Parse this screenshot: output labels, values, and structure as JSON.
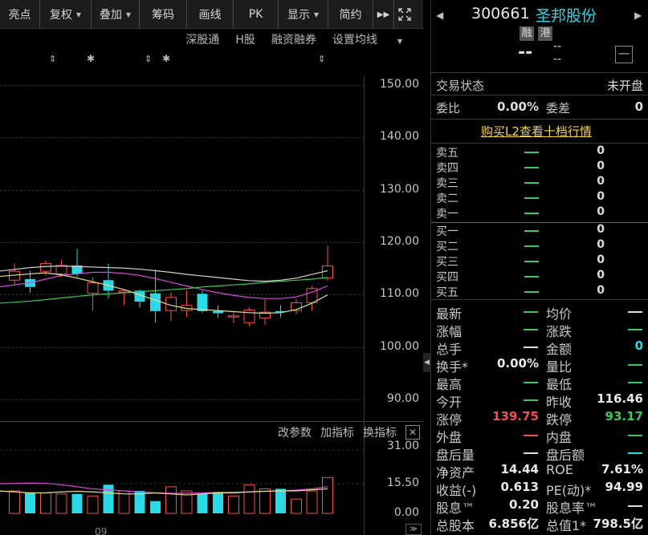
{
  "toolbar": {
    "items": [
      "亮点",
      "复权",
      "叠加",
      "筹码",
      "画线",
      "PK",
      "显示",
      "简约"
    ]
  },
  "subnav": [
    "深股通",
    "H股",
    "融资融券",
    "设置均线"
  ],
  "price_axis": [
    "150.00",
    "140.00",
    "130.00",
    "120.00",
    "110.00",
    "100.00",
    "90.00"
  ],
  "volume_axis": [
    "31.00",
    "15.50",
    "0.00"
  ],
  "volume_tools": [
    "改参数",
    "加指标",
    "换指标"
  ],
  "date_tick": "09",
  "stock": {
    "code": "300661",
    "name": "圣邦股份",
    "tag_margin": "融",
    "tag_hk": "港",
    "price": "--",
    "change_top": "--",
    "change_bottom": "--"
  },
  "status": {
    "label": "交易状态",
    "value": "未开盘"
  },
  "ratio": {
    "label1": "委比",
    "value1": "0.00%",
    "label2": "委差",
    "value2": "0"
  },
  "l2_link": "购买L2查看十档行情",
  "sells": [
    {
      "label": "卖五",
      "volume": "0"
    },
    {
      "label": "卖四",
      "volume": "0"
    },
    {
      "label": "卖三",
      "volume": "0"
    },
    {
      "label": "卖二",
      "volume": "0"
    },
    {
      "label": "卖一",
      "volume": "0"
    }
  ],
  "buys": [
    {
      "label": "买一",
      "volume": "0"
    },
    {
      "label": "买二",
      "volume": "0"
    },
    {
      "label": "买三",
      "volume": "0"
    },
    {
      "label": "买四",
      "volume": "0"
    },
    {
      "label": "买五",
      "volume": "0"
    }
  ],
  "quotes": [
    {
      "l1": "最新",
      "v1": "",
      "l2": "均价",
      "v2": ""
    },
    {
      "l1": "涨幅",
      "v1": "",
      "l2": "涨跌",
      "v2": ""
    },
    {
      "l1": "总手",
      "v1": "",
      "l2": "金额",
      "v2": "0"
    },
    {
      "l1": "换手*",
      "v1": "0.00%",
      "l2": "量比",
      "v2": ""
    },
    {
      "l1": "最高",
      "v1": "",
      "l2": "最低",
      "v2": ""
    },
    {
      "l1": "今开",
      "v1": "",
      "l2": "昨收",
      "v2": "116.46"
    },
    {
      "l1": "涨停",
      "v1": "139.75",
      "l2": "跌停",
      "v2": "93.17"
    },
    {
      "l1": "外盘",
      "v1": "",
      "l2": "内盘",
      "v2": ""
    },
    {
      "l1": "盘后量",
      "v1": "",
      "l2": "盘后额",
      "v2": ""
    },
    {
      "l1": "净资产",
      "v1": "14.44",
      "l2": "ROE",
      "v2": "7.61%"
    },
    {
      "l1": "收益(-)",
      "v1": "0.613",
      "l2": "PE(动)*",
      "v2": "94.99"
    },
    {
      "l1": "股息™",
      "v1": "0.20",
      "l2": "股息率™",
      "v2": ""
    },
    {
      "l1": "总股本",
      "v1": "6.856亿",
      "l2": "总值1*",
      "v2": "798.5亿"
    }
  ],
  "colors": {
    "up": "#f24f4f",
    "down": "#2ad8e6",
    "green": "#3cc95c",
    "accent": "#2ad8e6",
    "link": "#f1d54c"
  },
  "chart_data": {
    "type": "candlestick",
    "price_range": [
      85,
      155
    ],
    "volume_range": [
      0,
      31
    ],
    "candles": [
      {
        "o": 112.8,
        "c": 114.5,
        "h": 116.0,
        "l": 112.0,
        "v": 11.0
      },
      {
        "o": 113.0,
        "c": 111.5,
        "h": 114.6,
        "l": 110.4,
        "v": 10.0
      },
      {
        "o": 114.5,
        "c": 116.0,
        "h": 116.6,
        "l": 113.7,
        "v": 10.0
      },
      {
        "o": 114.0,
        "c": 115.6,
        "h": 116.6,
        "l": 113.4,
        "v": 9.5
      },
      {
        "o": 115.6,
        "c": 114.0,
        "h": 118.8,
        "l": 113.4,
        "v": 9.5
      },
      {
        "o": 110.3,
        "c": 112.3,
        "h": 113.3,
        "l": 107.0,
        "v": 8.5
      },
      {
        "o": 112.8,
        "c": 110.8,
        "h": 115.9,
        "l": 109.3,
        "v": 14.0
      },
      {
        "o": 110.5,
        "c": 110.8,
        "h": 110.8,
        "l": 108.0,
        "v": 11.0
      },
      {
        "o": 110.8,
        "c": 108.7,
        "h": 111.0,
        "l": 107.6,
        "v": 11.0
      },
      {
        "o": 110.3,
        "c": 106.9,
        "h": 114.8,
        "l": 104.7,
        "v": 6.0
      },
      {
        "o": 107.0,
        "c": 109.5,
        "h": 110.5,
        "l": 105.0,
        "v": 13.0
      },
      {
        "o": 107.0,
        "c": 108.0,
        "h": 110.9,
        "l": 105.8,
        "v": 11.0
      },
      {
        "o": 110.2,
        "c": 106.9,
        "h": 110.8,
        "l": 106.6,
        "v": 9.5
      },
      {
        "o": 106.9,
        "c": 106.5,
        "h": 108.0,
        "l": 105.6,
        "v": 10.5
      },
      {
        "o": 106.0,
        "c": 106.0,
        "h": 106.8,
        "l": 104.6,
        "v": 8.5
      },
      {
        "o": 104.7,
        "c": 107.1,
        "h": 107.6,
        "l": 104.0,
        "v": 14.0
      },
      {
        "o": 105.6,
        "c": 106.7,
        "h": 109.2,
        "l": 104.3,
        "v": 12.0
      },
      {
        "o": 106.9,
        "c": 106.7,
        "h": 108.0,
        "l": 105.7,
        "v": 12.0
      },
      {
        "o": 107.0,
        "c": 108.5,
        "h": 109.2,
        "l": 106.3,
        "v": 7.0
      },
      {
        "o": 108.5,
        "c": 111.2,
        "h": 111.7,
        "l": 107.0,
        "v": 11.0
      },
      {
        "o": 113.2,
        "c": 115.5,
        "h": 119.3,
        "l": 112.7,
        "v": 17.5
      }
    ],
    "ma_white": [
      114.5,
      115.2,
      115.4,
      115.5,
      115.4,
      115.3,
      115.2,
      115.1,
      114.9,
      114.6,
      114.3,
      113.9,
      113.6,
      113.3,
      113.0,
      112.7,
      112.6,
      112.8,
      113.2,
      113.9,
      114.6
    ],
    "ma_magenta": [
      111.5,
      112.3,
      113.0,
      113.7,
      114.0,
      114.3,
      114.3,
      114.1,
      113.7,
      113.1,
      112.4,
      111.7,
      111.0,
      110.4,
      109.9,
      109.5,
      109.3,
      109.3,
      109.6,
      110.5,
      111.7
    ],
    "ma_green": [
      108.4,
      108.8,
      109.1,
      109.4,
      109.7,
      110.0,
      110.2,
      110.4,
      110.6,
      110.8,
      111.0,
      111.2,
      111.5,
      111.7,
      111.9,
      112.1,
      112.4,
      112.6,
      112.8,
      113.0,
      113.3
    ],
    "ma_yellow": [
      113.5,
      114.0,
      114.2,
      113.8,
      113.2,
      112.5,
      111.8,
      111.0,
      110.0,
      109.0,
      108.0,
      107.4,
      107.2,
      107.0,
      106.8,
      106.6,
      106.5,
      106.6,
      107.2,
      108.4,
      110.0
    ],
    "vol_ma_magenta": [
      14.5,
      14.8,
      14.7,
      14.0,
      13.0,
      12.0,
      11.5,
      11.0,
      10.5,
      10.0,
      9.8,
      9.8,
      10.0,
      10.2,
      10.3,
      10.5,
      10.8,
      11.0,
      11.4,
      12.0,
      13.0
    ],
    "vol_ma_yellow": [
      11.0,
      10.0,
      10.0,
      10.5,
      10.8,
      10.5,
      10.0,
      9.5,
      9.5,
      10.0,
      9.5,
      9.0,
      9.5,
      10.0,
      10.0,
      10.5,
      10.8,
      11.0,
      11.0,
      11.5,
      12.0
    ]
  }
}
